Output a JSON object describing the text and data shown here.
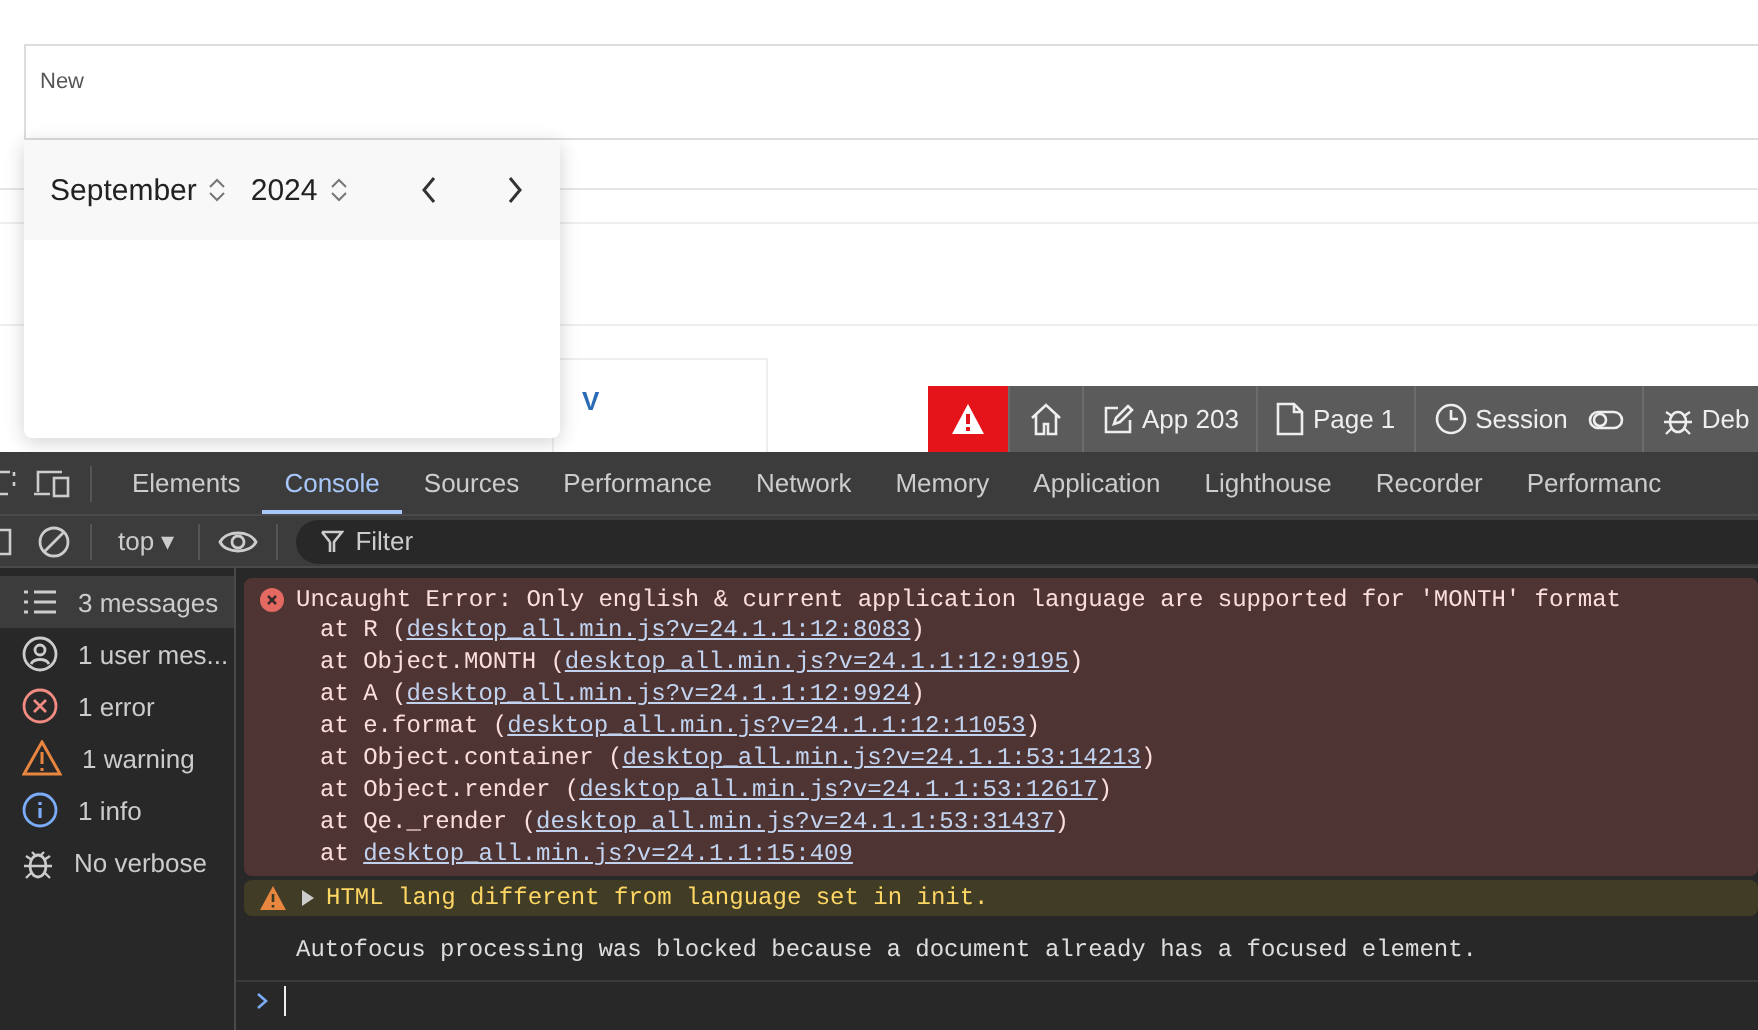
{
  "page": {
    "field_label": "New",
    "card_link": "V"
  },
  "date_picker": {
    "month": "September",
    "year": "2024"
  },
  "dev_toolbar": {
    "items": [
      {
        "kind": "error"
      },
      {
        "kind": "home"
      },
      {
        "kind": "edit",
        "label": "App 203"
      },
      {
        "kind": "page",
        "label": "Page 1"
      },
      {
        "kind": "session",
        "label": "Session"
      },
      {
        "kind": "debug",
        "label": "Deb"
      }
    ]
  },
  "devtools": {
    "tabs": [
      {
        "label": "Elements",
        "selected": false
      },
      {
        "label": "Console",
        "selected": true
      },
      {
        "label": "Sources",
        "selected": false
      },
      {
        "label": "Performance",
        "selected": false
      },
      {
        "label": "Network",
        "selected": false
      },
      {
        "label": "Memory",
        "selected": false
      },
      {
        "label": "Application",
        "selected": false
      },
      {
        "label": "Lighthouse",
        "selected": false
      },
      {
        "label": "Recorder",
        "selected": false
      },
      {
        "label": "Performanc",
        "selected": false
      }
    ],
    "context": "top ▾",
    "filter_placeholder": "Filter",
    "sidebar": [
      {
        "kind": "list",
        "label": "3 messages",
        "selected": true
      },
      {
        "kind": "user",
        "label": "1 user mes...",
        "selected": false
      },
      {
        "kind": "error",
        "label": "1 error",
        "selected": false
      },
      {
        "kind": "warning",
        "label": "1 warning",
        "selected": false
      },
      {
        "kind": "info",
        "label": "1 info",
        "selected": false
      },
      {
        "kind": "verbose",
        "label": "No verbose",
        "selected": false
      }
    ],
    "messages": [
      {
        "kind": "error",
        "text": "Uncaught Error: Only english & current application language are supported for 'MONTH' format",
        "frames": [
          {
            "before": "at R (",
            "link": "desktop_all.min.js?v=24.1.1:12:8083",
            "after": ")"
          },
          {
            "before": "at Object.MONTH (",
            "link": "desktop_all.min.js?v=24.1.1:12:9195",
            "after": ")"
          },
          {
            "before": "at A (",
            "link": "desktop_all.min.js?v=24.1.1:12:9924",
            "after": ")"
          },
          {
            "before": "at e.format (",
            "link": "desktop_all.min.js?v=24.1.1:12:11053",
            "after": ")"
          },
          {
            "before": "at Object.container (",
            "link": "desktop_all.min.js?v=24.1.1:53:14213",
            "after": ")"
          },
          {
            "before": "at Object.render (",
            "link": "desktop_all.min.js?v=24.1.1:53:12617",
            "after": ")"
          },
          {
            "before": "at Qe._render (",
            "link": "desktop_all.min.js?v=24.1.1:53:31437",
            "after": ")"
          },
          {
            "before": "at ",
            "link": "desktop_all.min.js?v=24.1.1:15:409"
          }
        ]
      },
      {
        "kind": "warning",
        "text": "HTML lang different from language set in init."
      },
      {
        "kind": "info",
        "text": "Autofocus processing was blocked because a document already has a focused element."
      }
    ]
  }
}
